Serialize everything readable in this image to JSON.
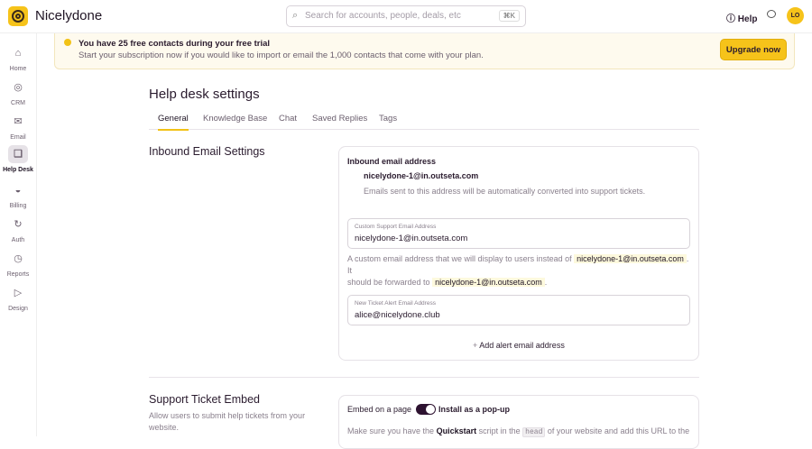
{
  "app": {
    "name": "Nicelydone"
  },
  "search": {
    "placeholder": "Search for accounts, people, deals, etc",
    "shortcut": "⌘K"
  },
  "header": {
    "help": "Help",
    "avatar": "LO"
  },
  "sidebar": {
    "items": [
      {
        "label": "Home",
        "icon": "⌂"
      },
      {
        "label": "CRM",
        "icon": "◎"
      },
      {
        "label": "Email",
        "icon": "✉"
      },
      {
        "label": "Help Desk",
        "icon": "❏"
      },
      {
        "label": "Billing",
        "icon": "◒"
      },
      {
        "label": "Auth",
        "icon": "↻"
      },
      {
        "label": "Reports",
        "icon": "◷"
      },
      {
        "label": "Design",
        "icon": "▷"
      }
    ]
  },
  "banner": {
    "title": "You have 25 free contacts during your free trial",
    "text": "Start your subscription now if you would like to import or email the 1,000 contacts that come with your plan.",
    "button": "Upgrade now"
  },
  "page": {
    "title": "Help desk settings",
    "tabs": [
      "General",
      "Knowledge Base",
      "Chat",
      "Saved Replies",
      "Tags"
    ]
  },
  "inbound": {
    "section": "Inbound Email Settings",
    "label": "Inbound email address",
    "address": "nicelydone-1@in.outseta.com",
    "note": "Emails sent to this address will be automatically converted into support tickets.",
    "custom_label": "Custom Support Email Address",
    "custom_value": "nicelydone-1@in.outseta.com",
    "custom_help_1": "A custom email address that we will display to users instead of",
    "custom_help_2": ". It",
    "custom_help_3": "should be forwarded to",
    "custom_help_4": ".",
    "alert_label": "New Ticket Alert Email Address",
    "alert_value": "alice@nicelydone.club",
    "add_alert": "Add alert email address"
  },
  "embed": {
    "section": "Support Ticket Embed",
    "desc": "Allow users to submit help tickets from your website.",
    "left": "Embed on a page",
    "right": "Install as a pop-up",
    "text_1": "Make sure you have the",
    "quickstart": "Quickstart",
    "text_2": "script in the",
    "head": "head",
    "text_3": "of your website and add this URL to the",
    "toggle_on": true
  }
}
